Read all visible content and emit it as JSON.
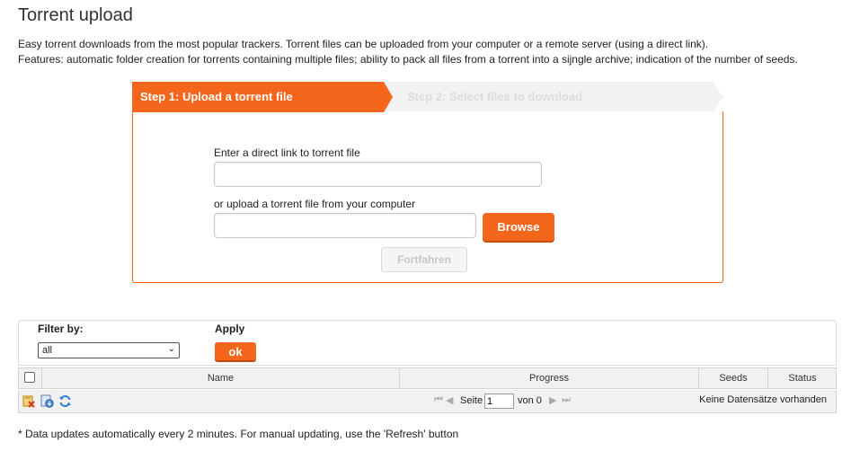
{
  "page": {
    "title": "Torrent upload",
    "desc_line1": "Easy torrent downloads from the most popular trackers. Torrent files can be uploaded from your computer or a remote server (using a direct link).",
    "desc_line2": "Features: automatic folder creation for torrents containing multiple files; ability to pack all files from a torrent into a sijngle archive; indication of the number of seeds."
  },
  "steps": {
    "step1": "Step 1: Upload a torrent file",
    "step2": "Step 2: Select files to download"
  },
  "form": {
    "link_label": "Enter a direct link to torrent file",
    "link_value": "",
    "file_label": "or upload a torrent file from your computer",
    "file_value": "",
    "browse_label": "Browse",
    "continue_label": "Fortfahren"
  },
  "filter": {
    "filter_label": "Filter by:",
    "apply_label": "Apply",
    "selected": "all",
    "ok_label": "ok"
  },
  "grid": {
    "columns": [
      "Name",
      "Progress",
      "Seeds",
      "Status"
    ],
    "page_label": "Seite",
    "page_value": "1",
    "of_label": "von 0",
    "no_records": "Keine Datensätze vorhanden"
  },
  "footnote": "* Data updates automatically every 2 minutes. For manual updating, use the 'Refresh' button",
  "colors": {
    "accent": "#f4661b",
    "step_inactive": "#f2f2f2",
    "grid_header": "#f1f1f1"
  }
}
